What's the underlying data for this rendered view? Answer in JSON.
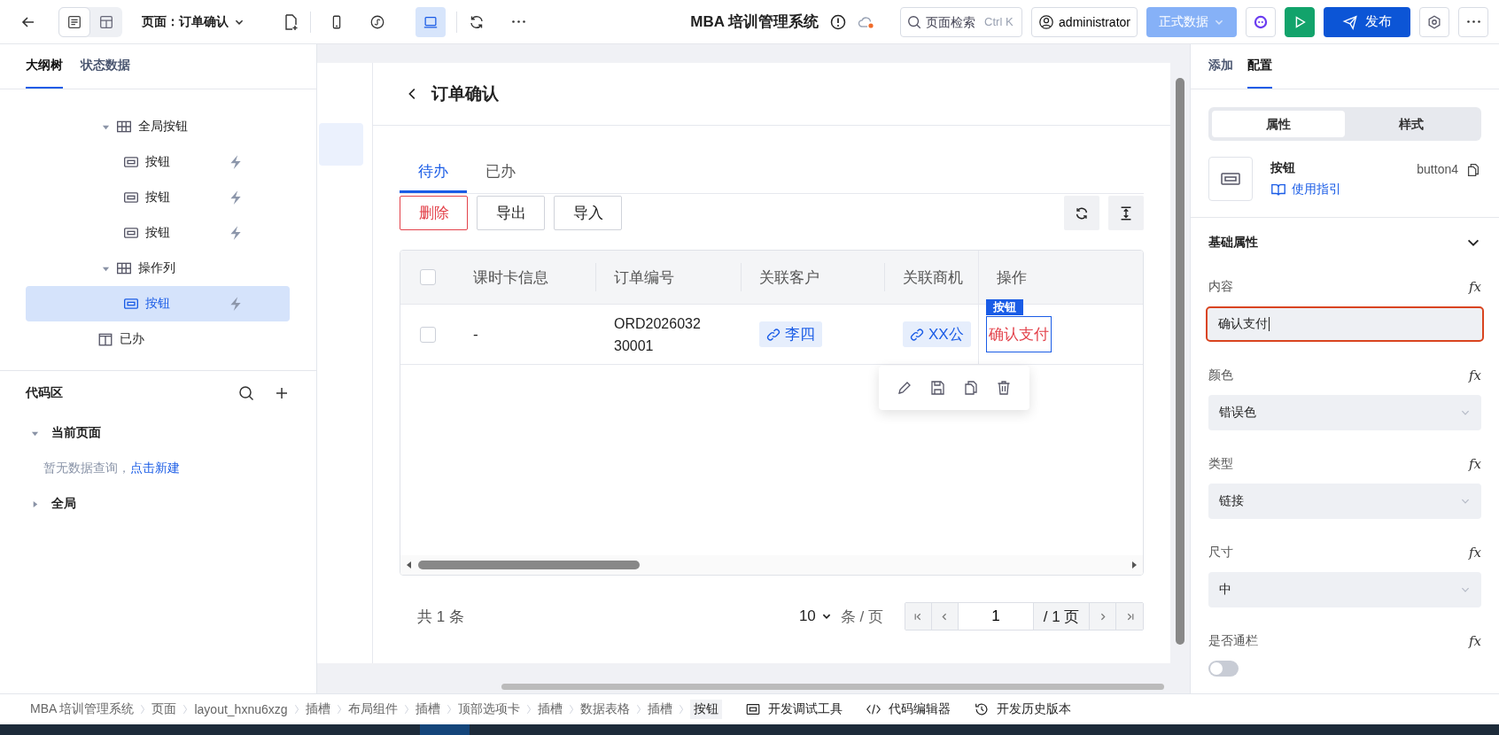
{
  "topbar": {
    "views": [
      {
        "kind": "outline",
        "selected": true
      },
      {
        "kind": "layout",
        "selected": false
      }
    ],
    "page_label": "页面：订单确认",
    "devices": [
      {
        "kind": "mobile",
        "selected": false
      },
      {
        "kind": "miniapp",
        "selected": false
      },
      {
        "kind": "desktop",
        "selected": true
      }
    ],
    "title": "MBA 培训管理系统",
    "search": {
      "placeholder": "页面检索",
      "shortcut": "Ctrl K"
    },
    "user": "administrator",
    "env": "正式数据",
    "publish": "发布"
  },
  "left": {
    "tabs": [
      {
        "label": "大纲树",
        "selected": true
      },
      {
        "label": "状态数据",
        "selected": false
      }
    ],
    "tree": [
      {
        "label": "全局按钮",
        "kind": "table",
        "expanded": true,
        "children": [
          {
            "label": "按钮",
            "kind": "button",
            "selected": false
          },
          {
            "label": "按钮",
            "kind": "button",
            "selected": false
          },
          {
            "label": "按钮",
            "kind": "button",
            "selected": false
          }
        ]
      },
      {
        "label": "操作列",
        "kind": "table",
        "expanded": true,
        "children": [
          {
            "label": "按钮",
            "kind": "button",
            "selected": true
          }
        ]
      },
      {
        "label": "已办",
        "kind": "panel"
      }
    ],
    "code_area": {
      "title": "代码区",
      "sections": [
        {
          "label": "当前页面",
          "expanded": true,
          "empty_text": "暂无数据查询，",
          "link": "点击新建"
        },
        {
          "label": "全局",
          "expanded": false
        }
      ]
    }
  },
  "canvas": {
    "page_title": "订单确认",
    "tabs": [
      {
        "label": "待办",
        "selected": true
      },
      {
        "label": "已办",
        "selected": false
      }
    ],
    "actions": [
      {
        "label": "删除",
        "kind": "danger"
      },
      {
        "label": "导出",
        "kind": "default"
      },
      {
        "label": "导入",
        "kind": "default"
      }
    ],
    "table": {
      "header_checked": false,
      "columns": [
        "课时卡信息",
        "订单编号",
        "关联客户",
        "关联商机",
        "操作"
      ],
      "rows": [
        {
          "checked": false,
          "info": "-",
          "order_no": "ORD202603230001",
          "customer": "李四",
          "opportunity": "XX公",
          "action": "确认支付"
        }
      ],
      "selection_tag": "按钮"
    },
    "pagination": {
      "total": "共 1 条",
      "page_size": "10",
      "per_page": "条 / 页",
      "page": "1",
      "pages": "/ 1 页"
    }
  },
  "right": {
    "tabs": [
      {
        "label": "添加",
        "selected": false
      },
      {
        "label": "配置",
        "selected": true
      }
    ],
    "segments": [
      {
        "label": "属性",
        "selected": true
      },
      {
        "label": "样式",
        "selected": false
      }
    ],
    "component": {
      "name": "按钮",
      "id": "button4",
      "guide": "使用指引"
    },
    "section": {
      "title": "基础属性",
      "expanded": true
    },
    "fields": [
      {
        "label": "内容",
        "kind": "input",
        "value": "确认支付",
        "focused": true,
        "fx": "fx"
      },
      {
        "label": "颜色",
        "kind": "select",
        "value": "错误色",
        "fx": "fx"
      },
      {
        "label": "类型",
        "kind": "select",
        "value": "链接",
        "fx": "fx"
      },
      {
        "label": "尺寸",
        "kind": "select",
        "value": "中",
        "fx": "fx"
      },
      {
        "label": "是否通栏",
        "kind": "switch",
        "on": false,
        "fx": "fx"
      }
    ]
  },
  "breadcrumb": [
    {
      "label": "MBA 培训管理系统",
      "selected": false
    },
    {
      "label": "页面",
      "selected": false
    },
    {
      "label": "layout_hxnu6xzg",
      "selected": false
    },
    {
      "label": "插槽",
      "selected": false
    },
    {
      "label": "布局组件",
      "selected": false
    },
    {
      "label": "插槽",
      "selected": false
    },
    {
      "label": "顶部选项卡",
      "selected": false
    },
    {
      "label": "插槽",
      "selected": false
    },
    {
      "label": "数据表格",
      "selected": false
    },
    {
      "label": "插槽",
      "selected": false
    },
    {
      "label": "按钮",
      "selected": true
    }
  ],
  "dev_tools": [
    {
      "label": "开发调试工具",
      "kind": "debug"
    },
    {
      "label": "代码编辑器",
      "kind": "code"
    },
    {
      "label": "开发历史版本",
      "kind": "history"
    }
  ]
}
